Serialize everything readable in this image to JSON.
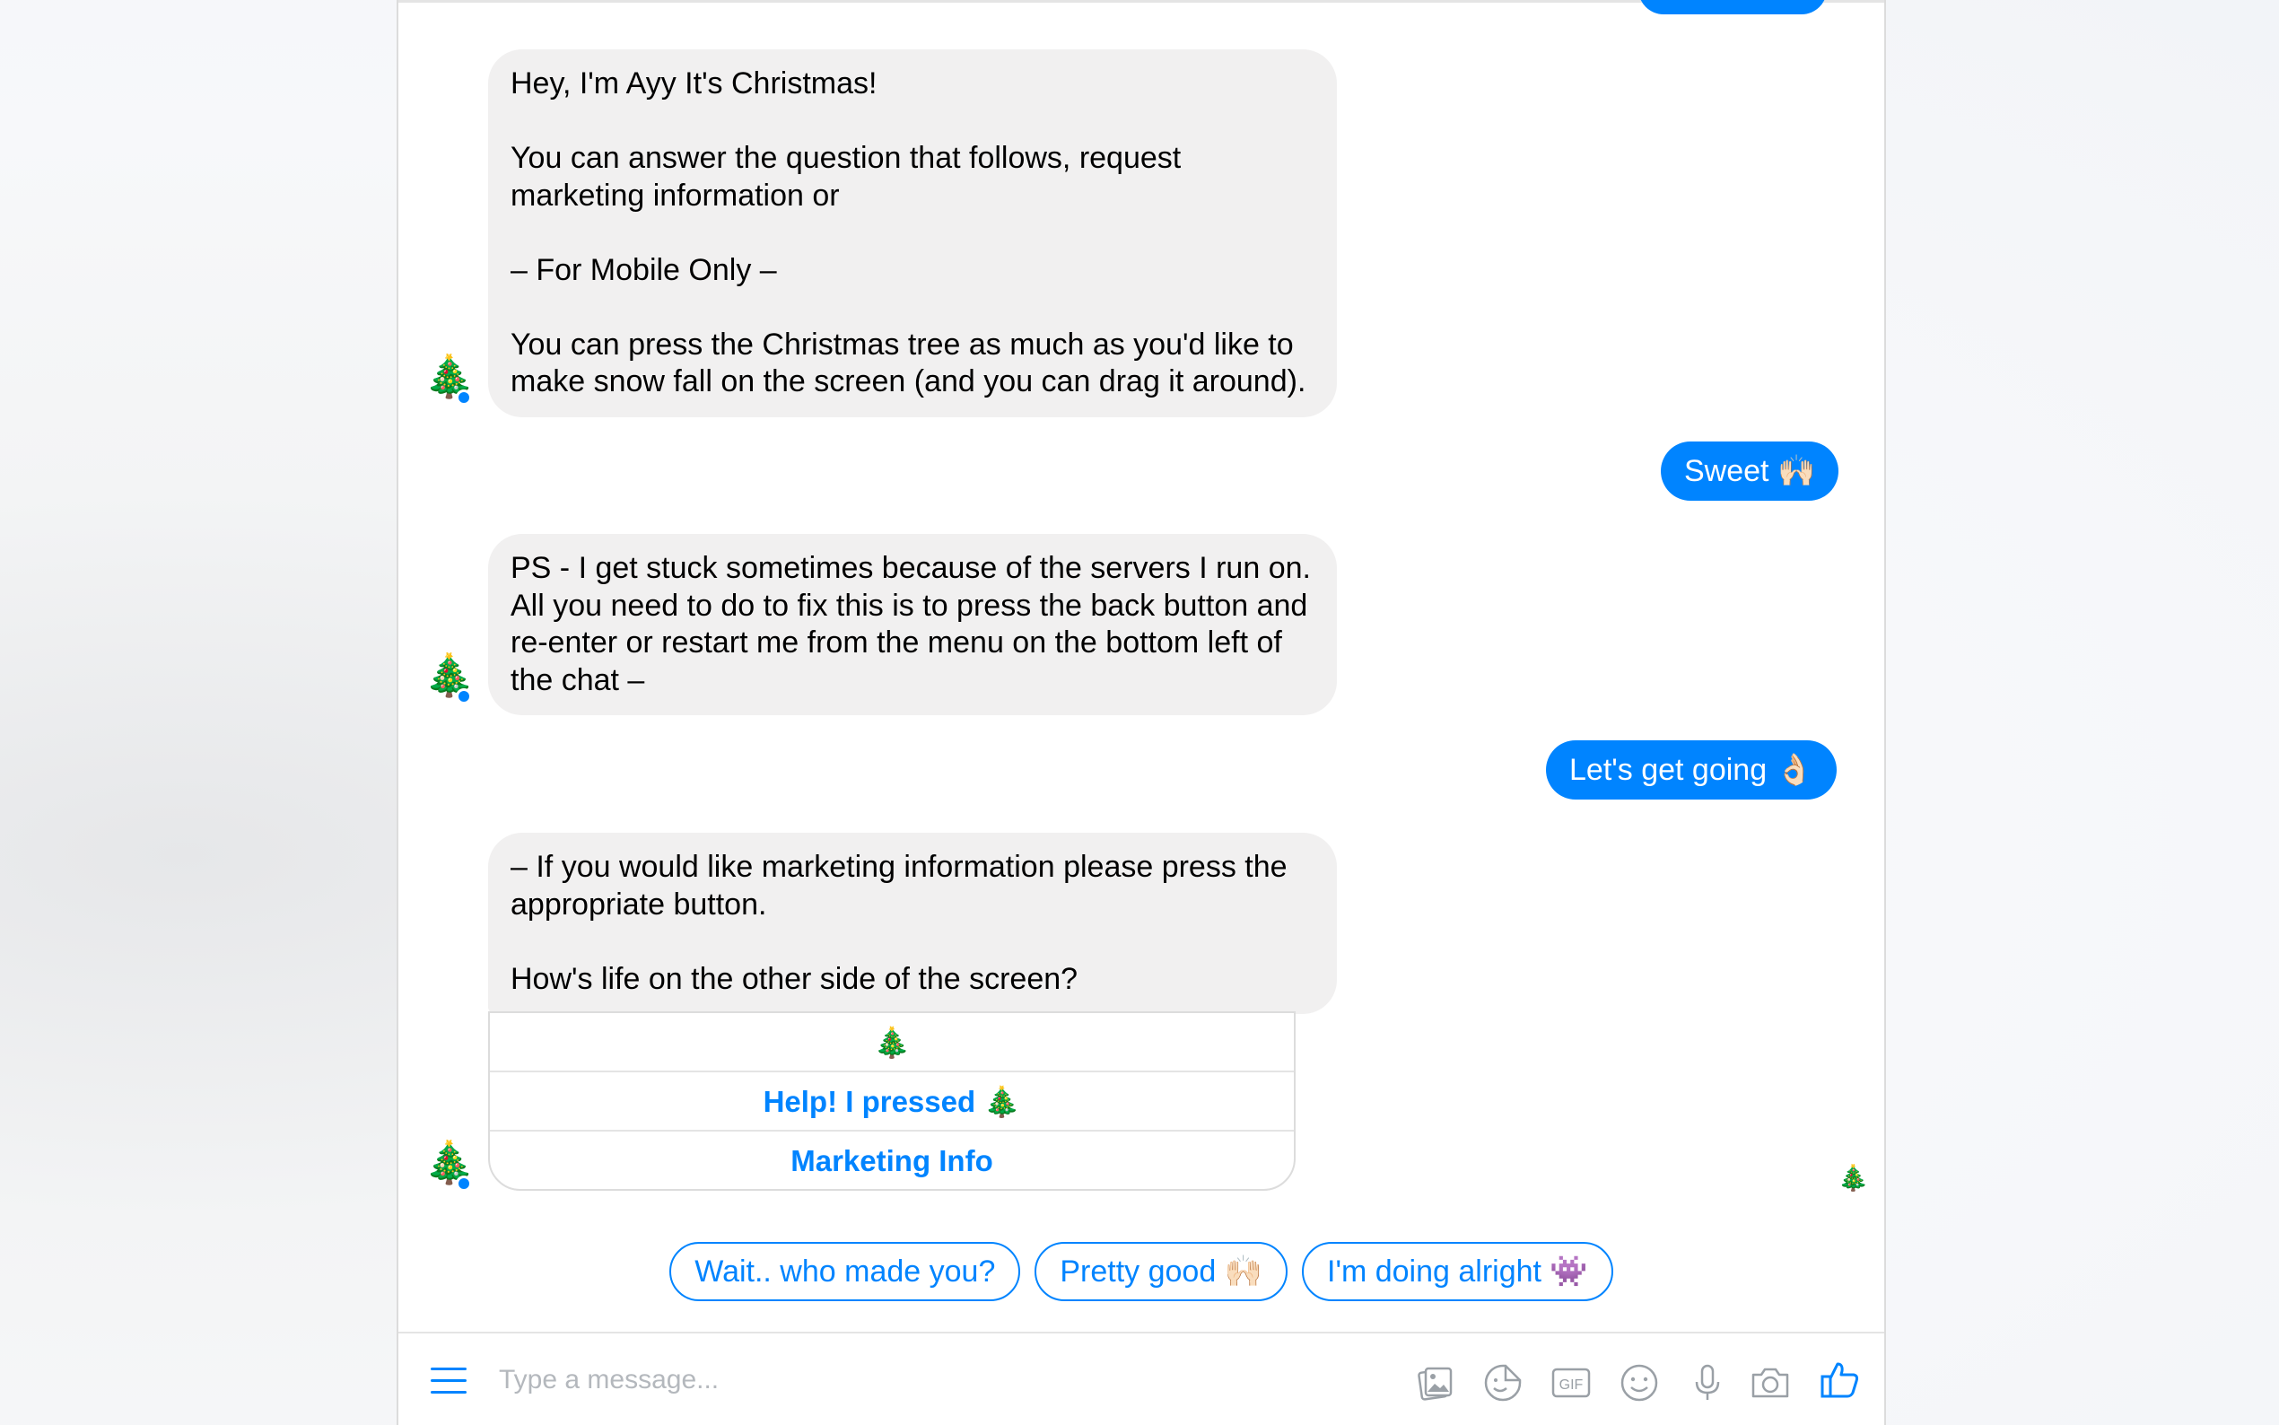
{
  "messages": [
    {
      "from": "bot",
      "text": "Hey, I'm Ayy It's Christmas!\n\nYou can answer the question that follows, request marketing information or\n\n– For Mobile Only –\n\nYou can press the Christmas tree as much as you'd like to make snow fall on the screen (and you can drag it around)."
    },
    {
      "from": "user",
      "text": "Sweet 🙌🏻"
    },
    {
      "from": "bot",
      "text": "PS - I get stuck sometimes because of the servers I run on. All you need to do to fix this is to press the back button and re-enter or restart me from the menu on the bottom left of the chat –"
    },
    {
      "from": "user",
      "text": "Let's get going 👌🏻"
    },
    {
      "from": "bot",
      "text": "– If you would like marketing information please press the appropriate button.\n\nHow's life on the other side of the screen?"
    }
  ],
  "bot_avatar": "🎄",
  "card_buttons": [
    "🎄",
    "Help! I pressed 🎄",
    "Marketing Info"
  ],
  "quick_replies": [
    "Wait.. who made you?",
    "Pretty good 🙌🏻",
    "I'm doing alright 👾"
  ],
  "floating_tree": "🎄",
  "composer": {
    "placeholder": "Type a message...",
    "icons": [
      "menu-icon",
      "image-icon",
      "sticker-icon",
      "gif-icon",
      "emoji-icon",
      "microphone-icon",
      "camera-icon",
      "thumbs-up-icon"
    ],
    "gif_label": "GIF"
  },
  "colors": {
    "accent": "#0084ff",
    "incoming_bubble": "#f1f0f0",
    "background": "#ffffff"
  }
}
